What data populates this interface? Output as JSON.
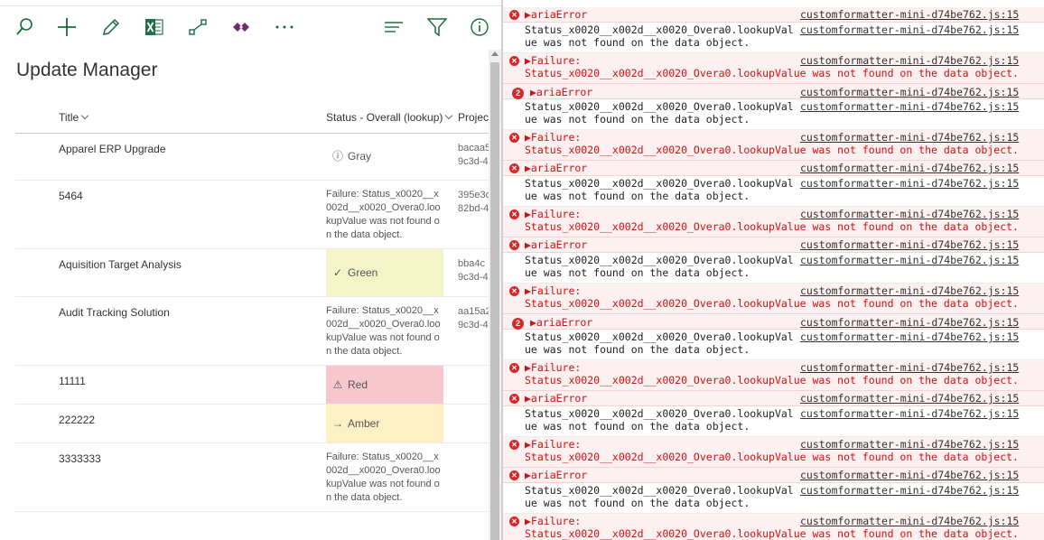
{
  "toolbar": {
    "icons": [
      "search-icon",
      "plus-icon",
      "edit-icon",
      "excel-icon",
      "flow-icon",
      "powerapps-icon",
      "more-icon",
      "view-options-icon",
      "filter-icon",
      "info-icon"
    ],
    "excel_color": "#1e7145",
    "powerapps_color": "#742774",
    "accent": "#1a6b3a"
  },
  "page": {
    "title": "Update Manager"
  },
  "list": {
    "columns": [
      "Title",
      "Status - Overall (lookup)",
      "Projec"
    ],
    "rows": [
      {
        "title": "Apparel ERP Upgrade",
        "status_kind": "pill",
        "status_icon": "info",
        "status": "Gray",
        "pill_color": "",
        "proj": [
          "bacaa5",
          "9c3d-4"
        ]
      },
      {
        "title": "5464",
        "status_kind": "text",
        "status": "Failure: Status_x0020__x002d__x0020_Overa0.lookupValue was not found on the data object.",
        "proj": [
          "395e3c",
          "82bd-4"
        ]
      },
      {
        "title": "Aquisition Target Analysis",
        "status_kind": "pill",
        "status_icon": "check",
        "status": "Green",
        "pill_color": "#f3f4c8",
        "proj": [
          "bba4c",
          "9c3d-4"
        ]
      },
      {
        "title": "Audit Tracking Solution",
        "status_kind": "text",
        "status": "Failure: Status_x0020__x002d__x0020_Overa0.lookupValue was not found on the data object.",
        "proj": [
          "aa15a2",
          "9c3d-4"
        ]
      },
      {
        "title": "11111",
        "status_kind": "pill",
        "status_icon": "warning",
        "status": "Red",
        "pill_color": "#f7c7cd",
        "proj": [
          "",
          ""
        ]
      },
      {
        "title": "222222",
        "status_kind": "pill",
        "status_icon": "arrow",
        "status": "Amber",
        "pill_color": "#fcf0c4",
        "proj": [
          "",
          ""
        ]
      },
      {
        "title": "3333333",
        "status_kind": "text",
        "status": "Failure: Status_x0020__x002d__x0020_Overa0.lookupValue was not found on the data object.",
        "proj": [
          "",
          ""
        ]
      }
    ]
  },
  "console": {
    "source": "customformatter-mini-d74be762.js:15",
    "entries": [
      {
        "kind": "err",
        "badge": "x",
        "lines": [
          "▶ariaError"
        ]
      },
      {
        "kind": "plain",
        "lines": [
          "Status_x0020__x002d__x0020_Overa0.lookupVal",
          "ue was not found on the data object."
        ]
      },
      {
        "kind": "err",
        "badge": "x",
        "lines": [
          "▶Failure:",
          "Status_x0020__x002d__x0020_Overa0.lookupValue was not found on the data object."
        ]
      },
      {
        "kind": "err",
        "badge": "2",
        "lines": [
          "▶ariaError"
        ]
      },
      {
        "kind": "plain",
        "lines": [
          "Status_x0020__x002d__x0020_Overa0.lookupVal",
          "ue was not found on the data object."
        ]
      },
      {
        "kind": "err",
        "badge": "x",
        "lines": [
          "▶Failure:",
          "Status_x0020__x002d__x0020_Overa0.lookupValue was not found on the data object."
        ]
      },
      {
        "kind": "err",
        "badge": "x",
        "lines": [
          "▶ariaError"
        ]
      },
      {
        "kind": "plain",
        "lines": [
          "Status_x0020__x002d__x0020_Overa0.lookupVal",
          "ue was not found on the data object."
        ]
      },
      {
        "kind": "err",
        "badge": "x",
        "lines": [
          "▶Failure:",
          "Status_x0020__x002d__x0020_Overa0.lookupValue was not found on the data object."
        ]
      },
      {
        "kind": "err",
        "badge": "x",
        "lines": [
          "▶ariaError"
        ]
      },
      {
        "kind": "plain",
        "lines": [
          "Status_x0020__x002d__x0020_Overa0.lookupVal",
          "ue was not found on the data object."
        ]
      },
      {
        "kind": "err",
        "badge": "x",
        "lines": [
          "▶Failure:",
          "Status_x0020__x002d__x0020_Overa0.lookupValue was not found on the data object."
        ]
      },
      {
        "kind": "err",
        "badge": "2",
        "lines": [
          "▶ariaError"
        ]
      },
      {
        "kind": "plain",
        "lines": [
          "Status_x0020__x002d__x0020_Overa0.lookupVal",
          "ue was not found on the data object."
        ]
      },
      {
        "kind": "err",
        "badge": "x",
        "lines": [
          "▶Failure:",
          "Status_x0020__x002d__x0020_Overa0.lookupValue was not found on the data object."
        ]
      },
      {
        "kind": "err",
        "badge": "x",
        "lines": [
          "▶ariaError"
        ]
      },
      {
        "kind": "plain",
        "lines": [
          "Status_x0020__x002d__x0020_Overa0.lookupVal",
          "ue was not found on the data object."
        ]
      },
      {
        "kind": "err",
        "badge": "x",
        "lines": [
          "▶Failure:",
          "Status_x0020__x002d__x0020_Overa0.lookupValue was not found on the data object."
        ]
      },
      {
        "kind": "err",
        "badge": "x",
        "lines": [
          "▶ariaError"
        ]
      },
      {
        "kind": "plain",
        "lines": [
          "Status_x0020__x002d__x0020_Overa0.lookupVal",
          "ue was not found on the data object."
        ]
      },
      {
        "kind": "err",
        "badge": "x",
        "lines": [
          "▶Failure:",
          "Status_x0020__x002d__x0020_Overa0.lookupValue was not found on the data object."
        ]
      }
    ]
  }
}
